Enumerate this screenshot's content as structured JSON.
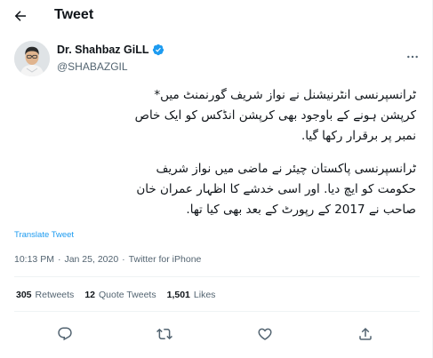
{
  "header": {
    "title": "Tweet"
  },
  "author": {
    "name": "Dr. Shahbaz GiLL",
    "handle": "@SHABAZGIL",
    "verified": true
  },
  "tweet": {
    "paragraph1": "ٹرانسپرنسی انٹرنیشنل نے نواز شریف گورنمنٹ میں*\nکرپشن ہونے کے باوجود بھی کرپشن انڈکس کو ایک خاص\nنمبر پر برقرار رکھا گیا.",
    "paragraph2": "ٹرانسپرنسی پاکستان چیئر نے ماضی میں نواز شریف\nحکومت کو ایچ دیا. اور اسی خدشے کا اظہار عمران خان\nصاحب نے 2017 کے رپورٹ کے بعد بھی کیا تھا."
  },
  "translate_label": "Translate Tweet",
  "meta": {
    "time": "10:13 PM",
    "separator": "·",
    "date": "Jan 25, 2020",
    "source": "Twitter for iPhone"
  },
  "stats": {
    "retweets": {
      "count": "305",
      "label": "Retweets"
    },
    "quotes": {
      "count": "12",
      "label": "Quote Tweets"
    },
    "likes": {
      "count": "1,501",
      "label": "Likes"
    }
  },
  "colors": {
    "accent": "#1d9bf0",
    "text": "#0f1419",
    "muted": "#536471",
    "border": "#eff3f4"
  },
  "icons": [
    "back-arrow-icon",
    "verified-badge-icon",
    "more-icon",
    "reply-icon",
    "retweet-icon",
    "like-icon",
    "share-icon"
  ]
}
